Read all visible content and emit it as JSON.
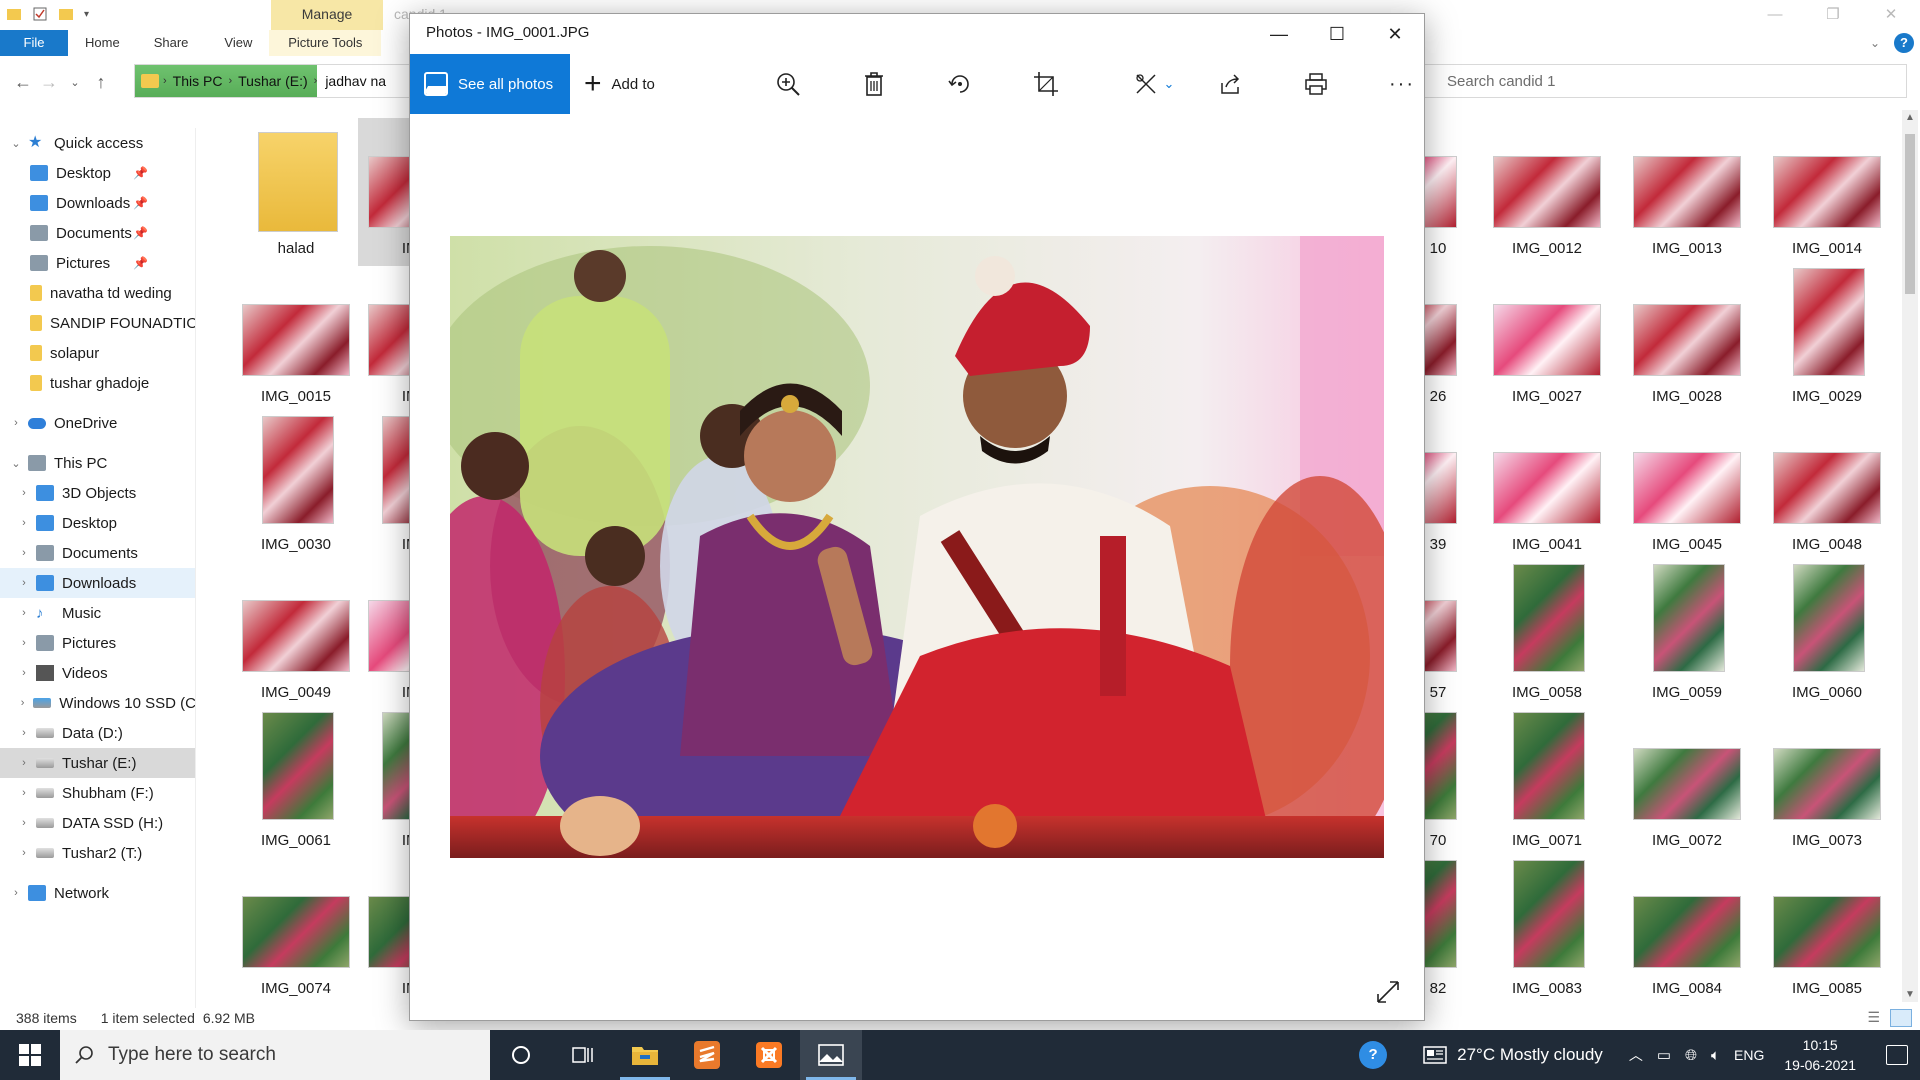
{
  "explorer": {
    "manage_tab": "Manage",
    "faded_title": "candid 1",
    "tabs": [
      "File",
      "Home",
      "Share",
      "View",
      "Picture Tools"
    ],
    "breadcrumbs": [
      "This PC",
      "Tushar (E:)",
      "jadhav na"
    ],
    "search_placeholder": "Search candid 1",
    "nav": {
      "quick_access": "Quick access",
      "quick_items": [
        "Desktop",
        "Downloads",
        "Documents",
        "Pictures",
        "navatha td weding",
        "SANDIP FOUNADTIO",
        "solapur",
        "tushar ghadoje"
      ],
      "onedrive": "OneDrive",
      "this_pc": "This PC",
      "pc_items": [
        "3D Objects",
        "Desktop",
        "Documents",
        "Downloads",
        "Music",
        "Pictures",
        "Videos",
        "Windows 10 SSD (C",
        "Data (D:)",
        "Tushar (E:)",
        "Shubham (F:)",
        "DATA SSD (H:)",
        "Tushar2 (T:)"
      ],
      "network": "Network"
    },
    "files_left": [
      [
        "halad",
        "IMG"
      ],
      [
        "IMG_0015",
        "IMG"
      ],
      [
        "IMG_0030",
        "IMG"
      ],
      [
        "IMG_0049",
        "IMG"
      ],
      [
        "IMG_0061",
        "IMG"
      ],
      [
        "IMG_0074",
        "IMG"
      ]
    ],
    "files_right_partial": [
      "10",
      "26",
      "39",
      "57",
      "70",
      "82"
    ],
    "files_right": [
      [
        "IMG_0012",
        "IMG_0013",
        "IMG_0014"
      ],
      [
        "IMG_0027",
        "IMG_0028",
        "IMG_0029"
      ],
      [
        "IMG_0041",
        "IMG_0045",
        "IMG_0048"
      ],
      [
        "IMG_0058",
        "IMG_0059",
        "IMG_0060"
      ],
      [
        "IMG_0071",
        "IMG_0072",
        "IMG_0073"
      ],
      [
        "IMG_0083",
        "IMG_0084",
        "IMG_0085"
      ]
    ],
    "status": {
      "count": "388 items",
      "selected": "1 item selected",
      "size": "6.92 MB"
    }
  },
  "photos": {
    "title": "Photos - IMG_0001.JPG",
    "see_all": "See all photos",
    "add_to": "Add to"
  },
  "taskbar": {
    "search_placeholder": "Type here to search",
    "weather": "27°C  Mostly cloudy",
    "lang": "ENG",
    "time": "10:15",
    "date": "19-06-2021"
  }
}
